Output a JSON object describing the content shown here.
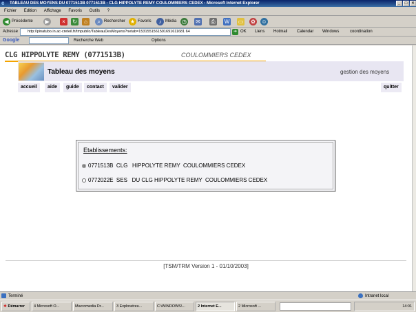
{
  "window": {
    "title": "TABLEAU DES MOYENS DU 0771513B  0771513B - CLG HIPPOLYTE REMY COULOMMIERS CEDEX - Microsoft Internet Explorer"
  },
  "menu": [
    "Fichier",
    "Edition",
    "Affichage",
    "Favoris",
    "Outils",
    "?"
  ],
  "toolbar": {
    "back_label": "Précédente",
    "search_label": "Rechercher",
    "favorites_label": "Favoris",
    "media_label": "Média"
  },
  "address": {
    "label": "Adresse",
    "url": "http://pinatubo.in.ac-creteil.fr/tmpublic/TableauDesMoyens?netab=1531551561591691611681 64",
    "go_label": "OK",
    "links_label": "Liens",
    "links": [
      "Hotmail",
      "Calendar",
      "Windows",
      "coordination"
    ]
  },
  "google": {
    "brand": "Google",
    "search_web_label": "Recherche Web",
    "options_label": "Options"
  },
  "page": {
    "school": "CLG HIPPOLYTE REMY (0771513B)",
    "city": "COULOMMIERS CEDEX",
    "title": "Tableau des moyens",
    "subtitle": "gestion des moyens",
    "nav": {
      "accueil": "accueil",
      "aide": "aide",
      "guide": "guide",
      "contact": "contact",
      "valider": "valider",
      "quitter": "quitter"
    },
    "etablissements": {
      "heading": "Etablissements:",
      "options": [
        {
          "label": "0771513B  CLG   HIPPOLYTE REMY  COULOMMIERS CEDEX",
          "selected": true
        },
        {
          "label": "0772022E  SES   DU CLG HIPPOLYTE REMY  COULOMMIERS CEDEX",
          "selected": false
        }
      ]
    },
    "version": "[TSM/TRM Version 1 - 01/10/2003]"
  },
  "status": {
    "left": "Terminé",
    "zone": "Intranet local"
  },
  "taskbar": {
    "start": "Démarrer",
    "tasks": [
      "4 Microsoft O...",
      "Macromedia Dr...",
      "3 Exploratreu...",
      "C:\\WINDOWS\\...",
      "2 Internet E...",
      "2 Microsoft ..."
    ],
    "clock": "14:01"
  }
}
